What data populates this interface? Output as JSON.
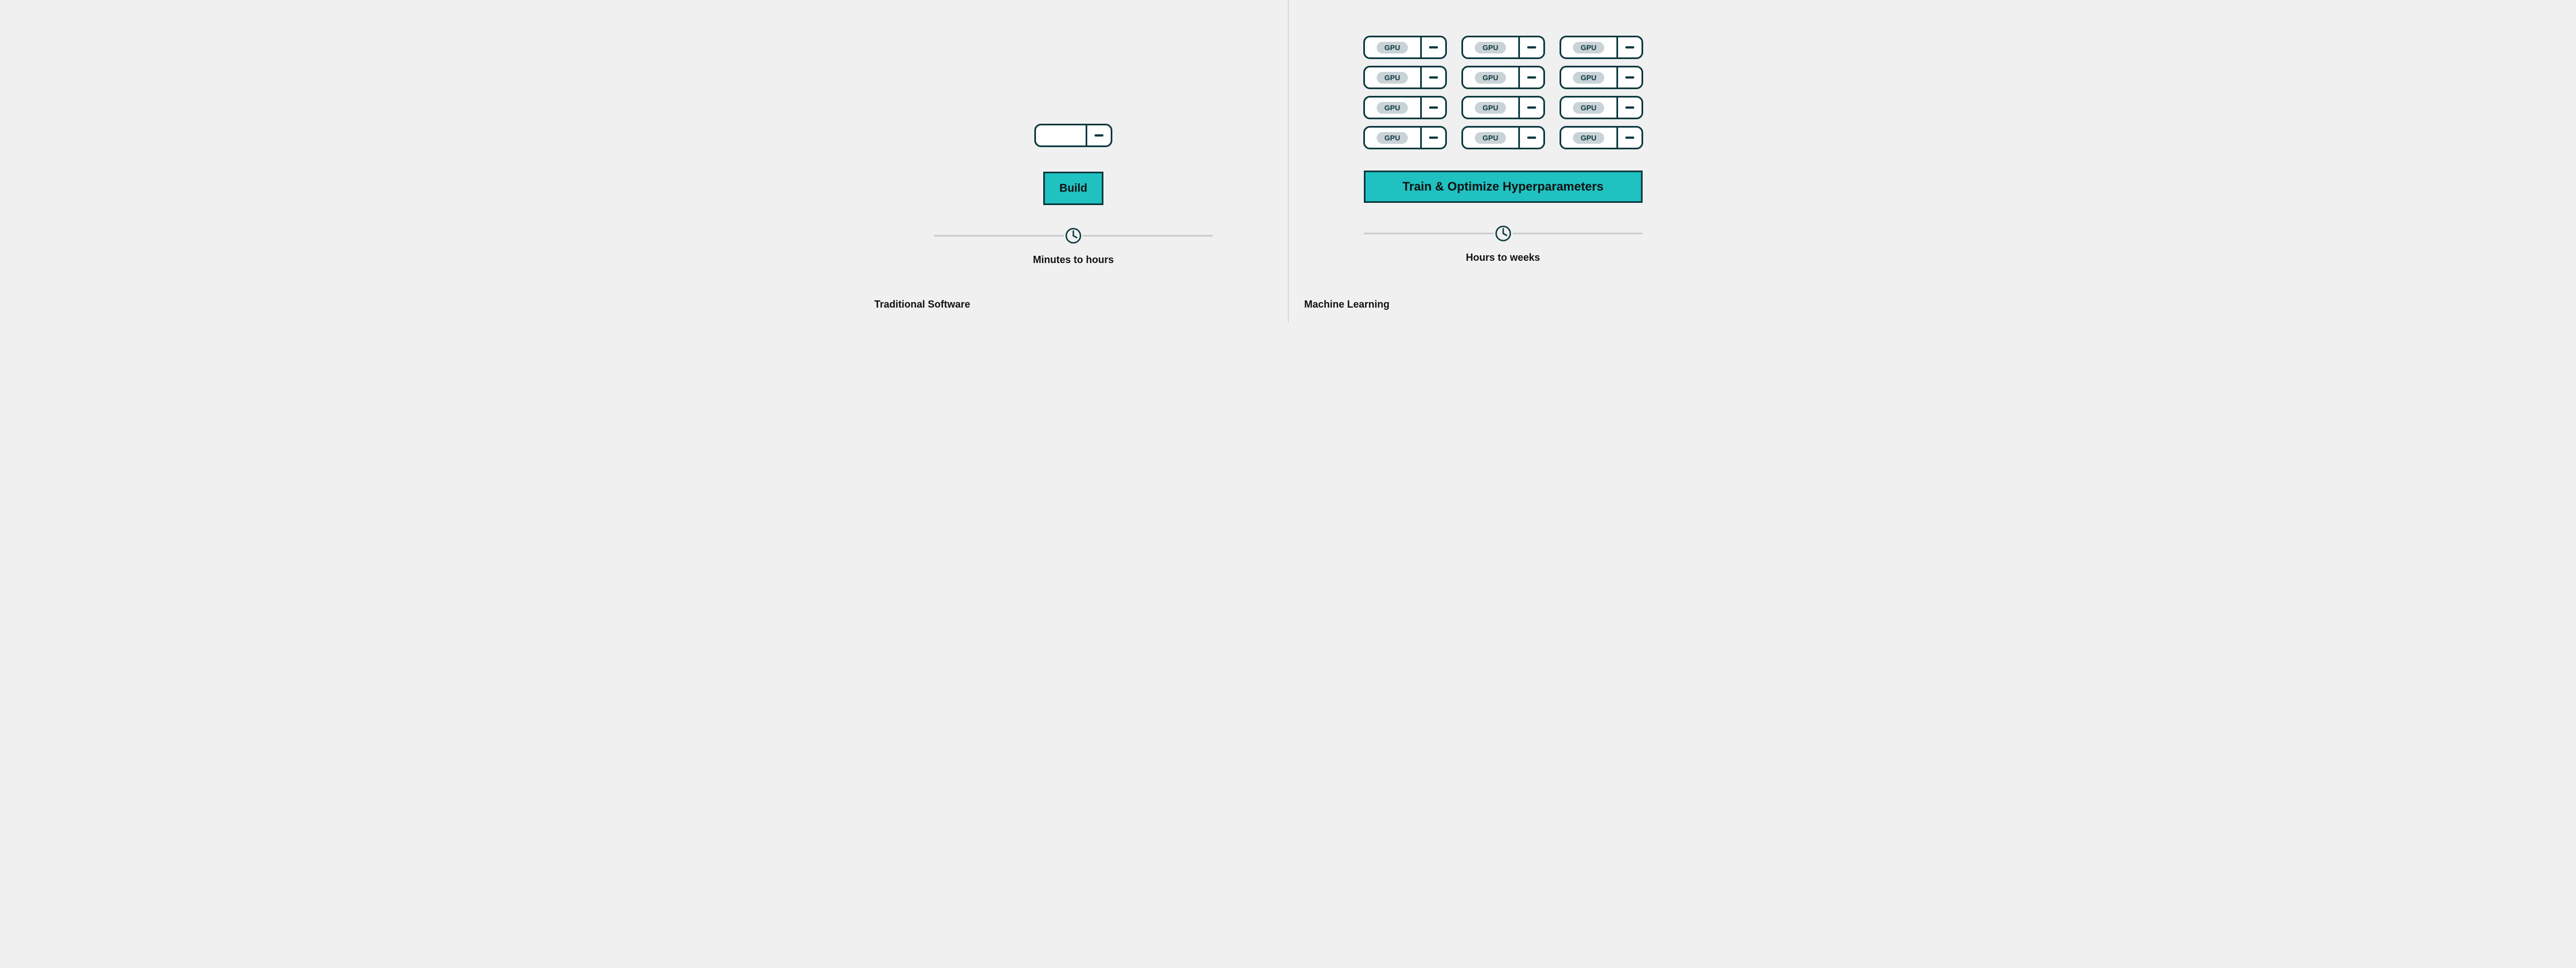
{
  "left": {
    "title": "Traditional Software",
    "action": "Build",
    "time_label": "Minutes to hours",
    "server": {
      "gpu_label": "",
      "marker": "-"
    }
  },
  "right": {
    "title": "Machine Learning",
    "action": "Train & Optimize Hyperparameters",
    "time_label": "Hours to weeks",
    "gpu_label": "GPU",
    "gpu_marker": "-",
    "gpu_rows": 4,
    "gpu_cols": 3
  }
}
